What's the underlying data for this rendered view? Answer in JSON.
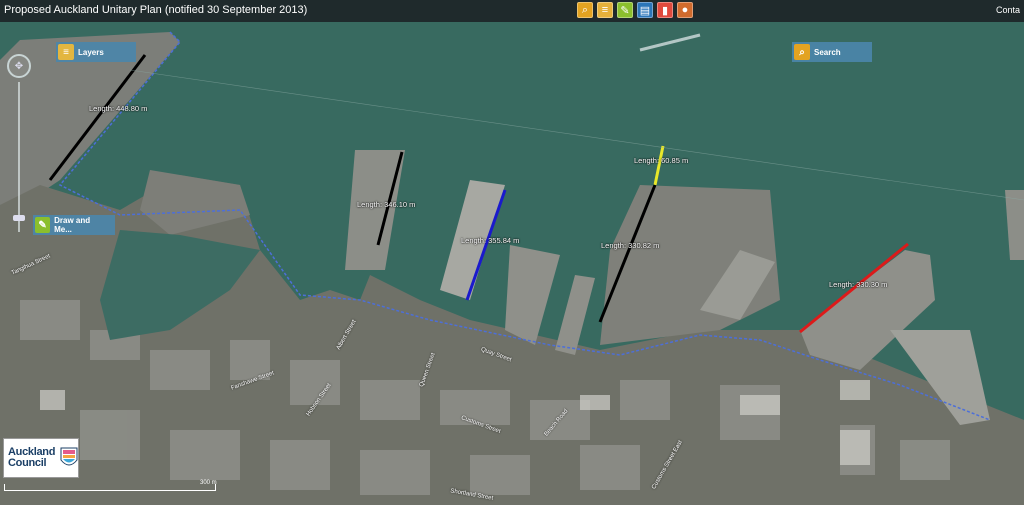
{
  "header": {
    "title": "Proposed Auckland Unitary Plan (notified 30 September 2013)",
    "contact": "Conta"
  },
  "toolbar": {
    "items": [
      {
        "name": "search-tool",
        "icon": "magnifier-icon",
        "color": "#e3a321"
      },
      {
        "name": "layers-tool",
        "icon": "layers-icon",
        "color": "#e5b13b"
      },
      {
        "name": "draw-tool",
        "icon": "pencil-icon",
        "color": "#8bbf2d"
      },
      {
        "name": "print-tool",
        "icon": "printer-icon",
        "color": "#2b76b8"
      },
      {
        "name": "bookmark-tool",
        "icon": "bookmark-icon",
        "color": "#e04a3d"
      },
      {
        "name": "location-tool",
        "icon": "pin-icon",
        "color": "#d06b2d"
      }
    ]
  },
  "panels": {
    "layers_label": "Layers",
    "draw_label": "Draw and Me...",
    "search_label": "Search"
  },
  "measurements": [
    {
      "label": "Length: 448.80 m",
      "color": "#000000"
    },
    {
      "label": "Length: 346.10 m",
      "color": "#000000"
    },
    {
      "label": "Length: 355.84 m",
      "color": "#1a1acc"
    },
    {
      "label": "Length: 60.85 m",
      "color": "#e8e82a"
    },
    {
      "label": "Length: 330.82 m",
      "color": "#000000"
    },
    {
      "label": "Length: 330.30 m",
      "color": "#dd1a1a"
    }
  ],
  "streets": [
    "Fanshawe Street",
    "Quay Street",
    "Customs Street",
    "Albert Street",
    "Hobson Street",
    "Queen Street",
    "Shortland Street",
    "Beach Road",
    "Tangihua Street",
    "Customs Street East"
  ],
  "logo": {
    "line1": "Auckland",
    "line2": "Council"
  },
  "scale": {
    "label": "300 m"
  }
}
